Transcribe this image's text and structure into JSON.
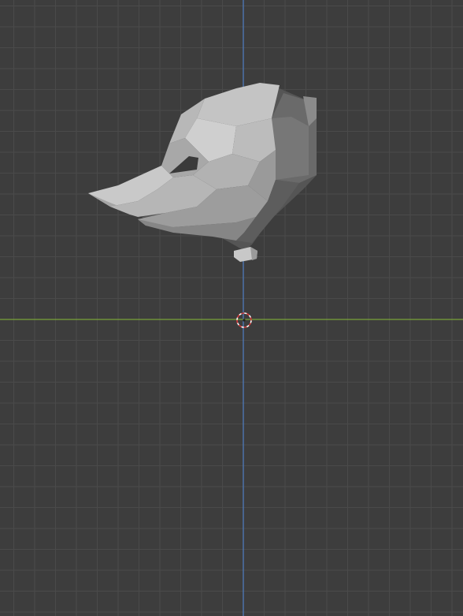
{
  "viewport": {
    "view": "front-orthographic",
    "background_color": "#3d3d3d",
    "grid_color": "#4a4a4a",
    "z_axis_color": "#4f7fc4",
    "x_axis_color": "#7aa33a",
    "object": {
      "name_icon": "mesh-object",
      "shading": "solid",
      "colors": {
        "light": "#c8c8c8",
        "mid": "#a8a8a8",
        "dark": "#6e6e6e",
        "shadow": "#4e4e4e"
      }
    },
    "cursor_icon": "3d-cursor-icon"
  }
}
